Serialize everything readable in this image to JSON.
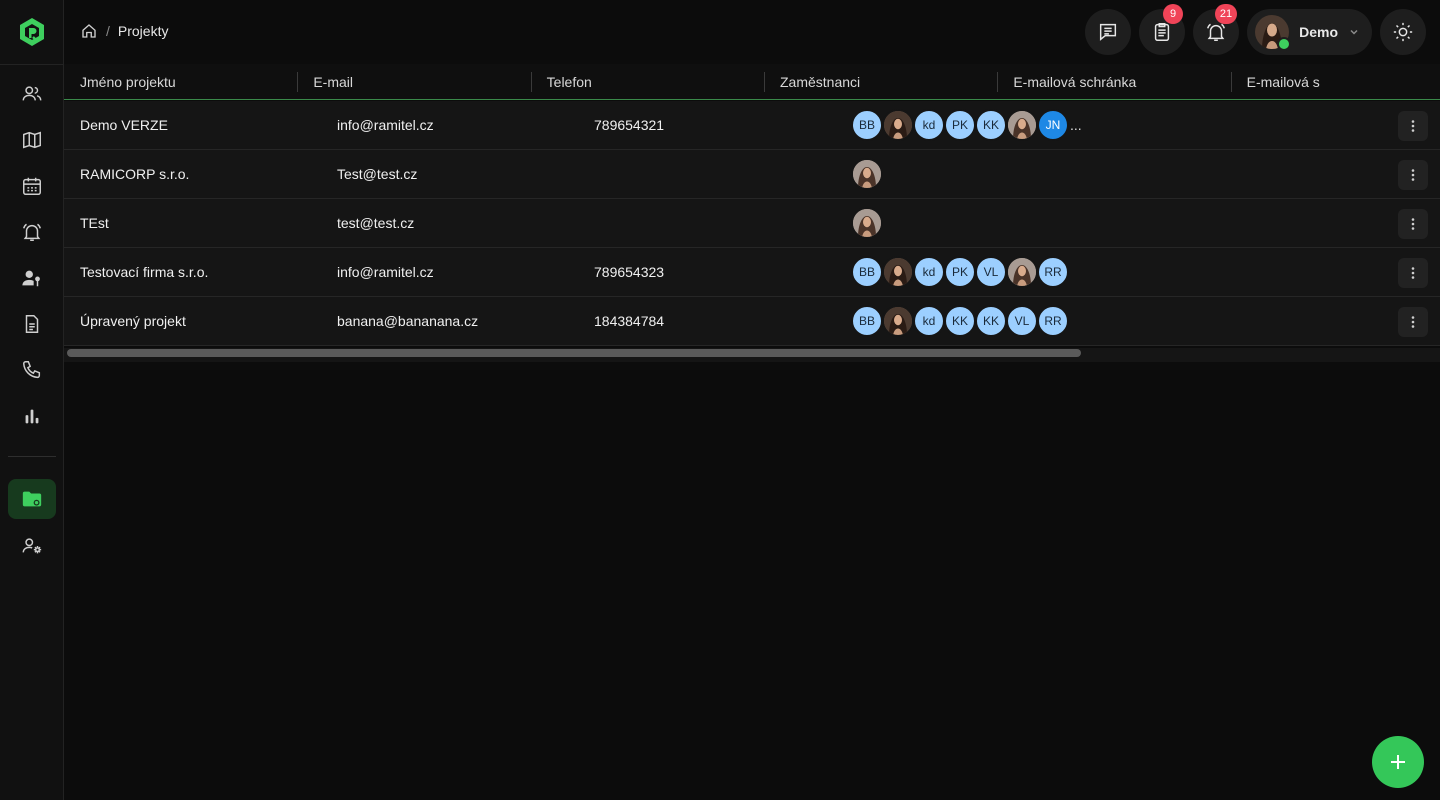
{
  "breadcrumb": {
    "current": "Projekty"
  },
  "header": {
    "tasks_badge": "9",
    "notifications_badge": "21",
    "user_name": "Demo"
  },
  "table": {
    "columns": [
      "Jméno projektu",
      "E-mail",
      "Telefon",
      "Zaměstnanci",
      "E-mailová schránka",
      "E-mailová s"
    ],
    "rows": [
      {
        "name": "Demo VERZE",
        "email": "info@ramitel.cz",
        "phone": "789654321",
        "employees": [
          "BB",
          "photo",
          "kd",
          "PK",
          "KK",
          "photo2",
          "JN"
        ],
        "more": "..."
      },
      {
        "name": "RAMICORP s.r.o.",
        "email": "Test@test.cz",
        "phone": "",
        "employees": [
          "photo2"
        ],
        "more": ""
      },
      {
        "name": "TEst",
        "email": "test@test.cz",
        "phone": "",
        "employees": [
          "photo2"
        ],
        "more": ""
      },
      {
        "name": "Testovací firma s.r.o.",
        "email": "info@ramitel.cz",
        "phone": "789654323",
        "employees": [
          "BB",
          "photo",
          "kd",
          "PK",
          "VL",
          "photo2",
          "RR"
        ],
        "more": ""
      },
      {
        "name": "Úpravený projekt",
        "email": "banana@bananana.cz",
        "phone": "184384784",
        "employees": [
          "BB",
          "photo",
          "kd",
          "KK",
          "KK",
          "VL",
          "RR"
        ],
        "more": ""
      }
    ]
  },
  "colors": {
    "accent": "#34c759",
    "avatar_light": "#9ccfff",
    "avatar_dark": "#1e88e5",
    "badge": "#f04458"
  }
}
